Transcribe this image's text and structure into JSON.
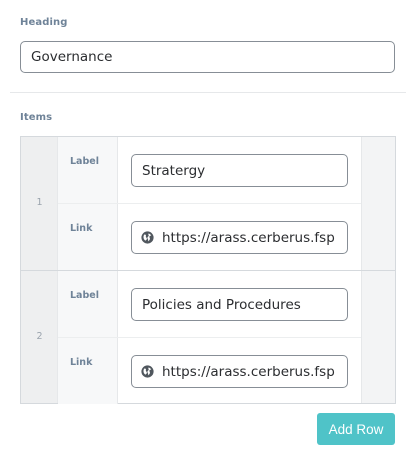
{
  "heading": {
    "label": "Heading",
    "value": "Governance"
  },
  "items": {
    "label": "Items",
    "rows": [
      {
        "number": "1",
        "label_field": {
          "label": "Label",
          "value": "Stratergy"
        },
        "link_field": {
          "label": "Link",
          "value": "https://arass.cerberus.fsp",
          "icon": "globe-icon"
        }
      },
      {
        "number": "2",
        "label_field": {
          "label": "Label",
          "value": "Policies and Procedures"
        },
        "link_field": {
          "label": "Link",
          "value": "https://arass.cerberus.fsp",
          "icon": "globe-icon"
        }
      }
    ]
  },
  "actions": {
    "add_row_label": "Add Row",
    "accent_color": "#4fc3c8"
  }
}
